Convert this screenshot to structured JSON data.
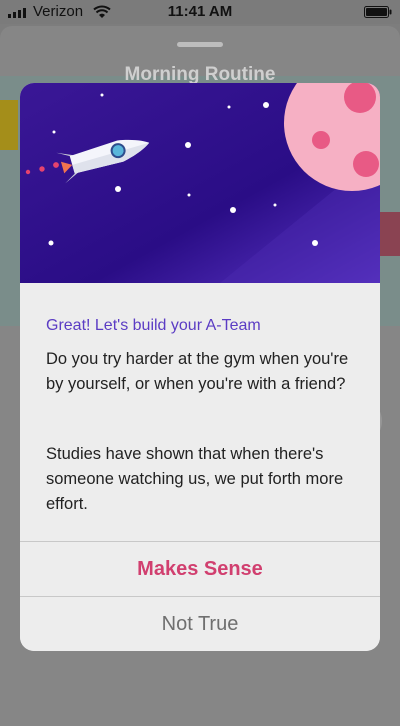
{
  "status_bar": {
    "carrier": "Verizon",
    "time": "11:41 AM"
  },
  "background": {
    "title": "Morning Routine"
  },
  "dialog": {
    "headline": "Great! Let's build your A-Team",
    "question": "Do you try harder at the gym when you're by yourself, or when you're with a friend?",
    "explanation": "Studies have shown that when there's someone watching us, we put forth more effort.",
    "primary_action": "Makes Sense",
    "secondary_action": "Not True"
  },
  "colors": {
    "accent_purple": "#5b3cc4",
    "primary_action": "#d13f6f",
    "secondary_action": "#6f6f6f",
    "planet": "#f6b0c4"
  },
  "icons": {
    "hero_art": "rocket-space-illustration"
  }
}
